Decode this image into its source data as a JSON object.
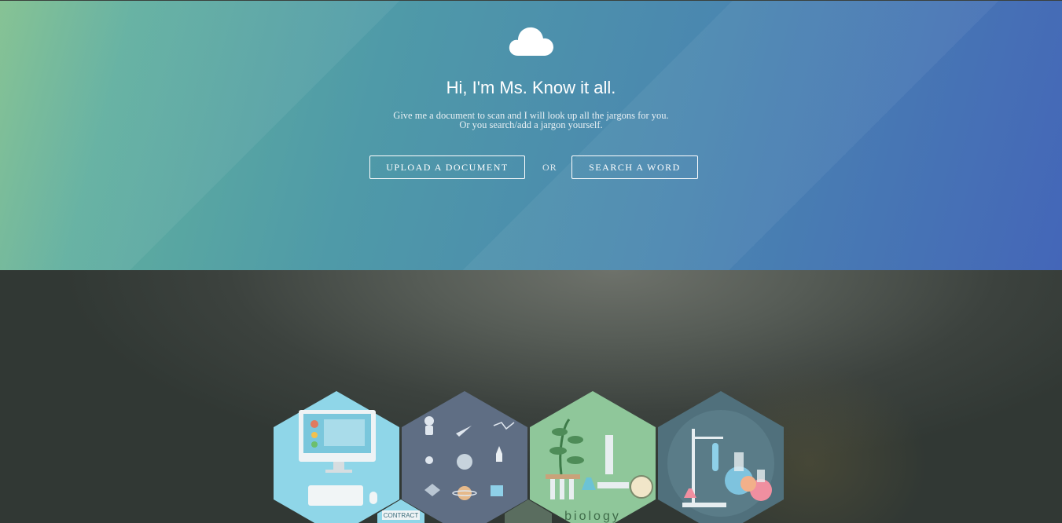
{
  "hero": {
    "title": "Hi, I'm Ms. Know it all.",
    "subtitle_line1": "Give me a document to scan and I will look up all the jargons for you.",
    "subtitle_line2": "Or you search/add a jargon yourself.",
    "upload_label": "UPLOAD A DOCUMENT",
    "or_label": "OR",
    "search_label": "SEARCH A WORD",
    "icon": "cloud-icon"
  },
  "gallery": {
    "tiles": [
      {
        "name": "technology",
        "icon": "computer-icon",
        "color": "#8fd6e8"
      },
      {
        "name": "space",
        "icon": "astronaut-icon",
        "color": "#5f6e84"
      },
      {
        "name": "biology",
        "icon": "microscope-icon",
        "color": "#8fc79a"
      },
      {
        "name": "chemistry",
        "icon": "flask-icon",
        "color": "#50707c"
      }
    ],
    "contract_label": "CONTRACT",
    "biology_label": "biology"
  }
}
